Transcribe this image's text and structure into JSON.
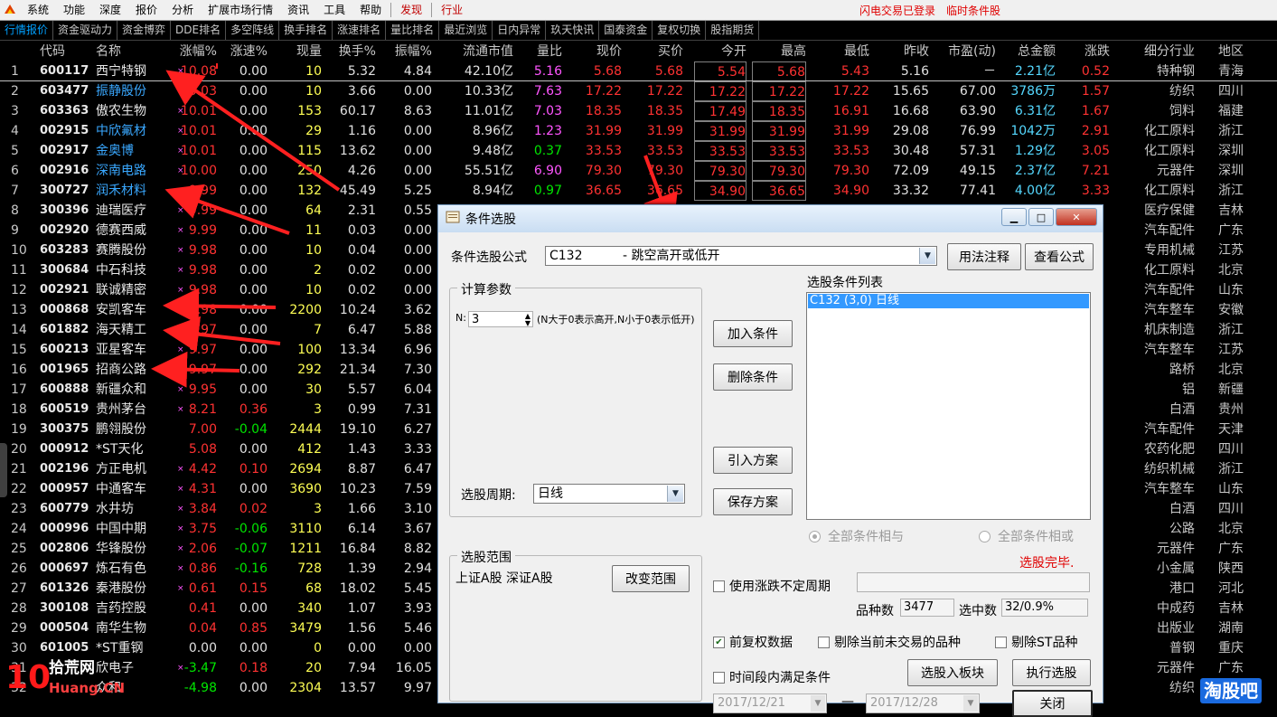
{
  "menu": {
    "items": [
      "系统",
      "功能",
      "深度",
      "报价",
      "分析",
      "扩展市场行情",
      "资讯",
      "工具",
      "帮助",
      "发现",
      "行业"
    ],
    "status_login": "闪电交易已登录",
    "status_cond": "临时条件股"
  },
  "tabs": [
    "行情报价",
    "资金驱动力",
    "资金博弈",
    "DDE排名",
    "多空阵线",
    "换手排名",
    "涨速排名",
    "量比排名",
    "最近浏览",
    "日内异常",
    "玖天快讯",
    "国泰资金",
    "复权切换",
    "股指期货"
  ],
  "table": {
    "headers": [
      "",
      "代码",
      "名称",
      "涨幅%",
      "涨速%",
      "现量",
      "换手%",
      "振幅%",
      "流通市值",
      "量比",
      "现价",
      "买价",
      "今开",
      "最高",
      "最低",
      "昨收",
      "市盈(动)",
      "总金额",
      "涨跌",
      "细分行业",
      "地区"
    ],
    "rows": [
      [
        "1",
        "600117",
        "西宁特钢",
        "10.08",
        "0.00",
        "10",
        "5.32",
        "4.84",
        "42.10亿",
        "5.16",
        "5.68",
        "5.68",
        "5.54",
        "5.68",
        "5.43",
        "5.16",
        "－",
        "2.21亿",
        "0.52",
        "特种钢",
        "青海"
      ],
      [
        "2",
        "603477",
        "振静股份",
        "10.03",
        "0.00",
        "10",
        "3.66",
        "0.00",
        "10.33亿",
        "7.63",
        "17.22",
        "17.22",
        "17.22",
        "17.22",
        "17.22",
        "15.65",
        "67.00",
        "3786万",
        "1.57",
        "纺织",
        "四川"
      ],
      [
        "3",
        "603363",
        "傲农生物",
        "10.01",
        "0.00",
        "153",
        "60.17",
        "8.63",
        "11.01亿",
        "7.03",
        "18.35",
        "18.35",
        "17.49",
        "18.35",
        "16.91",
        "16.68",
        "63.90",
        "6.31亿",
        "1.67",
        "饲料",
        "福建"
      ],
      [
        "4",
        "002915",
        "中欣氟材",
        "10.01",
        "0.00",
        "29",
        "1.16",
        "0.00",
        "8.96亿",
        "1.23",
        "31.99",
        "31.99",
        "31.99",
        "31.99",
        "31.99",
        "29.08",
        "76.99",
        "1042万",
        "2.91",
        "化工原料",
        "浙江"
      ],
      [
        "5",
        "002917",
        "金奥博",
        "10.01",
        "0.00",
        "115",
        "13.62",
        "0.00",
        "9.48亿",
        "0.37",
        "33.53",
        "33.53",
        "33.53",
        "33.53",
        "33.53",
        "30.48",
        "57.31",
        "1.29亿",
        "3.05",
        "化工原料",
        "深圳"
      ],
      [
        "6",
        "002916",
        "深南电路",
        "10.00",
        "0.00",
        "250",
        "4.26",
        "0.00",
        "55.51亿",
        "6.90",
        "79.30",
        "79.30",
        "79.30",
        "79.30",
        "79.30",
        "72.09",
        "49.15",
        "2.37亿",
        "7.21",
        "元器件",
        "深圳"
      ],
      [
        "7",
        "300727",
        "润禾材料",
        "9.99",
        "0.00",
        "132",
        "45.49",
        "5.25",
        "8.94亿",
        "0.97",
        "36.65",
        "36.65",
        "34.90",
        "36.65",
        "34.90",
        "33.32",
        "77.41",
        "4.00亿",
        "3.33",
        "化工原料",
        "浙江"
      ],
      [
        "8",
        "300396",
        "迪瑞医疗",
        "9.99",
        "0.00",
        "64",
        "2.31",
        "0.55",
        "",
        "",
        "",
        "",
        "",
        "",
        "",
        "",
        "",
        "",
        "",
        "医疗保健",
        "吉林"
      ],
      [
        "9",
        "002920",
        "德赛西威",
        "9.99",
        "0.00",
        "11",
        "0.03",
        "0.00",
        "",
        "",
        "",
        "",
        "",
        "",
        "",
        "",
        "",
        "",
        "",
        "汽车配件",
        "广东"
      ],
      [
        "10",
        "603283",
        "赛腾股份",
        "9.98",
        "0.00",
        "10",
        "0.04",
        "0.00",
        "",
        "",
        "",
        "",
        "",
        "",
        "",
        "",
        "",
        "",
        "",
        "专用机械",
        "江苏"
      ],
      [
        "11",
        "300684",
        "中石科技",
        "9.98",
        "0.00",
        "2",
        "0.02",
        "0.00",
        "",
        "",
        "",
        "",
        "",
        "",
        "",
        "",
        "",
        "",
        "",
        "化工原料",
        "北京"
      ],
      [
        "12",
        "002921",
        "联诚精密",
        "9.98",
        "0.00",
        "10",
        "0.02",
        "0.00",
        "",
        "",
        "",
        "",
        "",
        "",
        "",
        "",
        "",
        "",
        "",
        "汽车配件",
        "山东"
      ],
      [
        "13",
        "000868",
        "安凯客车",
        "9.98",
        "0.00",
        "2200",
        "10.24",
        "3.62",
        "",
        "",
        "",
        "",
        "",
        "",
        "",
        "",
        "",
        "",
        "",
        "汽车整车",
        "安徽"
      ],
      [
        "14",
        "601882",
        "海天精工",
        "9.97",
        "0.00",
        "7",
        "6.47",
        "5.88",
        "",
        "",
        "",
        "",
        "",
        "",
        "",
        "",
        "",
        "",
        "",
        "机床制造",
        "浙江"
      ],
      [
        "15",
        "600213",
        "亚星客车",
        "9.97",
        "0.00",
        "100",
        "13.34",
        "6.96",
        "",
        "",
        "",
        "",
        "",
        "",
        "",
        "",
        "",
        "",
        "",
        "汽车整车",
        "江苏"
      ],
      [
        "16",
        "001965",
        "招商公路",
        "9.97",
        "0.00",
        "292",
        "21.34",
        "7.30",
        "",
        "",
        "",
        "",
        "",
        "",
        "",
        "",
        "",
        "",
        "",
        "路桥",
        "北京"
      ],
      [
        "17",
        "600888",
        "新疆众和",
        "9.95",
        "0.00",
        "30",
        "5.57",
        "6.04",
        "",
        "",
        "",
        "",
        "",
        "",
        "",
        "",
        "",
        "",
        "",
        "铝",
        "新疆"
      ],
      [
        "18",
        "600519",
        "贵州茅台",
        "8.21",
        "0.36",
        "3",
        "0.99",
        "7.31",
        "",
        "",
        "",
        "",
        "",
        "",
        "",
        "",
        "",
        "",
        "",
        "白酒",
        "贵州"
      ],
      [
        "19",
        "300375",
        "鹏翎股份",
        "7.00",
        "-0.04",
        "2444",
        "19.10",
        "6.27",
        "",
        "",
        "",
        "",
        "",
        "",
        "",
        "",
        "",
        "",
        "",
        "汽车配件",
        "天津"
      ],
      [
        "20",
        "000912",
        "*ST天化",
        "5.08",
        "0.00",
        "412",
        "1.43",
        "3.33",
        "",
        "",
        "",
        "",
        "",
        "",
        "",
        "",
        "",
        "",
        "",
        "农药化肥",
        "四川"
      ],
      [
        "21",
        "002196",
        "方正电机",
        "4.42",
        "0.10",
        "2694",
        "8.87",
        "6.47",
        "",
        "",
        "",
        "",
        "",
        "",
        "",
        "",
        "",
        "",
        "",
        "纺织机械",
        "浙江"
      ],
      [
        "22",
        "000957",
        "中通客车",
        "4.31",
        "0.00",
        "3690",
        "10.23",
        "7.59",
        "",
        "",
        "",
        "",
        "",
        "",
        "",
        "",
        "",
        "",
        "",
        "汽车整车",
        "山东"
      ],
      [
        "23",
        "600779",
        "水井坊",
        "3.84",
        "0.02",
        "3",
        "1.66",
        "3.10",
        "",
        "",
        "",
        "",
        "",
        "",
        "",
        "",
        "",
        "",
        "",
        "白酒",
        "四川"
      ],
      [
        "24",
        "000996",
        "中国中期",
        "3.75",
        "-0.06",
        "3110",
        "6.14",
        "3.67",
        "",
        "",
        "",
        "",
        "",
        "",
        "",
        "",
        "",
        "",
        "",
        "公路",
        "北京"
      ],
      [
        "25",
        "002806",
        "华锋股份",
        "2.06",
        "-0.07",
        "1211",
        "16.84",
        "8.82",
        "",
        "",
        "",
        "",
        "",
        "",
        "",
        "",
        "",
        "",
        "",
        "元器件",
        "广东"
      ],
      [
        "26",
        "000697",
        "炼石有色",
        "0.86",
        "-0.16",
        "728",
        "1.39",
        "2.94",
        "",
        "",
        "",
        "",
        "",
        "",
        "",
        "",
        "",
        "",
        "",
        "小金属",
        "陕西"
      ],
      [
        "27",
        "601326",
        "秦港股份",
        "0.61",
        "0.15",
        "68",
        "18.02",
        "5.45",
        "",
        "",
        "",
        "",
        "",
        "",
        "",
        "",
        "",
        "",
        "",
        "港口",
        "河北"
      ],
      [
        "28",
        "300108",
        "吉药控股",
        "0.41",
        "0.00",
        "340",
        "1.07",
        "3.93",
        "",
        "",
        "",
        "",
        "",
        "",
        "",
        "",
        "",
        "",
        "",
        "中成药",
        "吉林"
      ],
      [
        "29",
        "000504",
        "南华生物",
        "0.04",
        "0.85",
        "3479",
        "1.56",
        "5.46",
        "",
        "",
        "",
        "",
        "",
        "",
        "",
        "",
        "",
        "",
        "",
        "出版业",
        "湖南"
      ],
      [
        "30",
        "601005",
        "*ST重钢",
        "0.00",
        "0.00",
        "0",
        "0.00",
        "0.00",
        "",
        "",
        "",
        "",
        "",
        "",
        "",
        "",
        "",
        "",
        "",
        "普钢",
        "重庆"
      ],
      [
        "31",
        "",
        "欣电子",
        "-3.47",
        "0.18",
        "20",
        "7.94",
        "16.05",
        "",
        "",
        "",
        "",
        "",
        "",
        "",
        "",
        "",
        "",
        "",
        "元器件",
        "广东"
      ],
      [
        "32",
        "",
        "众和",
        "-4.98",
        "0.00",
        "2304",
        "13.57",
        "9.97",
        "",
        "",
        "",
        "",
        "",
        "",
        "",
        "",
        "",
        "",
        "",
        "纺织",
        ""
      ]
    ]
  },
  "dialog": {
    "title": "条件选股",
    "formula_label": "条件选股公式",
    "formula_value": "C132          - 跳空高开或低开",
    "btn_usage": "用法注释",
    "btn_view": "查看公式",
    "params_group": "计算参数",
    "param_n_label": "N:",
    "param_n_value": "3",
    "param_n_desc": "(N大于0表示高开,N小于0表示低开)",
    "btn_add": "加入条件",
    "btn_delete": "删除条件",
    "btn_import": "引入方案",
    "btn_save": "保存方案",
    "list_label": "选股条件列表",
    "list_item": "C132 (3,0) 日线",
    "period_label": "选股周期:",
    "period_value": "日线",
    "radio_and": "全部条件相与",
    "radio_or": "全部条件相或",
    "done_text": "选股完毕.",
    "range_group": "选股范围",
    "range_value": "上证A股 深证A股",
    "btn_range": "改变范围",
    "chk_unfixed": "使用涨跌不定周期",
    "count_label": "品种数",
    "count_value": "3477",
    "hit_label": "选中数",
    "hit_value": "32/0.9%",
    "chk_fq": "前复权数据",
    "chk_notrade": "剔除当前未交易的品种",
    "chk_st": "剔除ST品种",
    "chk_timespan": "时间段内满足条件",
    "btn_toboard": "选股入板块",
    "btn_exec": "执行选股",
    "date_from": "2017/12/21",
    "date_sep": "—",
    "date_to": "2017/12/28",
    "btn_close": "关闭"
  },
  "watermark": {
    "left_a": "10",
    "left_b": "拾荒网",
    "left_c": "Huang.CN",
    "right": "淘股吧"
  }
}
